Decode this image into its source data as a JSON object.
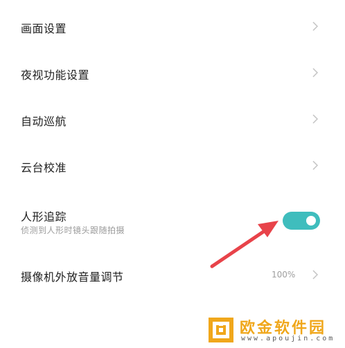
{
  "settings": {
    "items": [
      {
        "label": "画面设置"
      },
      {
        "label": "夜视功能设置"
      },
      {
        "label": "自动巡航"
      },
      {
        "label": "云台校准"
      },
      {
        "label": "人形追踪",
        "description": "侦测到人形时镜头跟随拍摄",
        "toggle_on": true
      },
      {
        "label": "摄像机外放音量调节",
        "value": "100%"
      }
    ]
  },
  "colors": {
    "toggle_on": "#3fbdbd",
    "annotation_arrow": "#e8434a",
    "watermark_accent": "#f0a71b"
  },
  "icons": {
    "chevron": "chevron-right-icon",
    "annotation": "red-arrow-annotation"
  },
  "watermark": {
    "title": "欧金软件园",
    "url": "www.apoujin.com"
  }
}
